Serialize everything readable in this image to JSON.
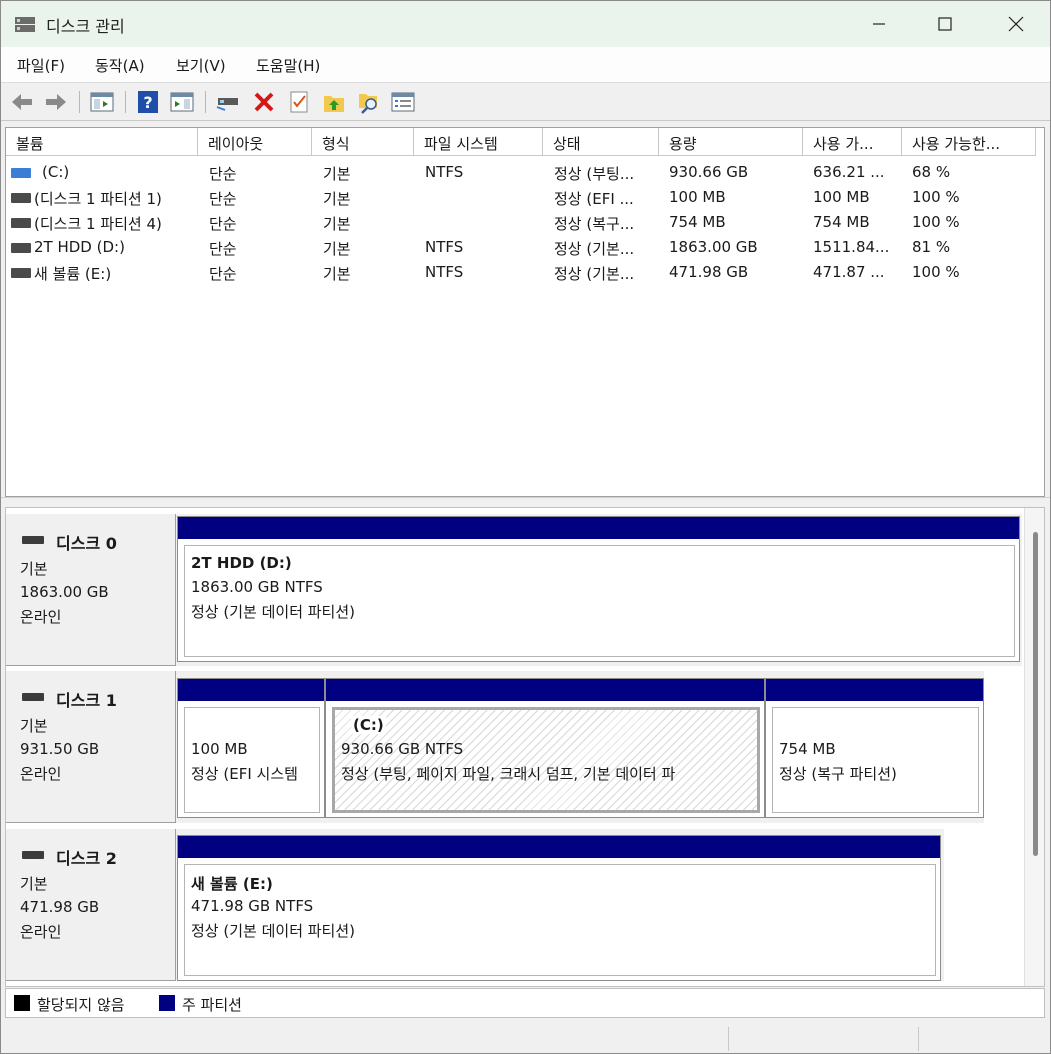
{
  "window": {
    "title": "디스크 관리"
  },
  "menu": [
    "파일(F)",
    "동작(A)",
    "보기(V)",
    "도움말(H)"
  ],
  "toolbar": {
    "icons": [
      "back-arrow-icon",
      "forward-arrow-icon",
      "console-tree-icon",
      "help-icon",
      "action-pane-icon",
      "connect-drive-icon",
      "delete-icon",
      "checklist-icon",
      "folder-up-icon",
      "search-folder-icon",
      "properties-icon"
    ]
  },
  "columns": [
    "볼륨",
    "레이아웃",
    "형식",
    "파일 시스템",
    "상태",
    "용량",
    "사용 가...",
    "사용 가능한..."
  ],
  "volumes": [
    {
      "name": "(C:)",
      "layout": "단순",
      "type": "기본",
      "fs": "NTFS",
      "status": "정상 (부팅...",
      "capacity": "930.66 GB",
      "free": "636.21 ...",
      "percent": "68 %",
      "icon_color": "#3a7ed6"
    },
    {
      "name": "(디스크 1 파티션 1)",
      "layout": "단순",
      "type": "기본",
      "fs": "",
      "status": "정상 (EFI ...",
      "capacity": "100 MB",
      "free": "100 MB",
      "percent": "100 %",
      "icon_color": "#4a4a4a"
    },
    {
      "name": "(디스크 1 파티션 4)",
      "layout": "단순",
      "type": "기본",
      "fs": "",
      "status": "정상 (복구...",
      "capacity": "754 MB",
      "free": "754 MB",
      "percent": "100 %",
      "icon_color": "#4a4a4a"
    },
    {
      "name": "2T HDD (D:)",
      "layout": "단순",
      "type": "기본",
      "fs": "NTFS",
      "status": "정상 (기본...",
      "capacity": "1863.00 GB",
      "free": "1511.84...",
      "percent": "81 %",
      "icon_color": "#4a4a4a"
    },
    {
      "name": "새 볼륨 (E:)",
      "layout": "단순",
      "type": "기본",
      "fs": "NTFS",
      "status": "정상 (기본...",
      "capacity": "471.98 GB",
      "free": "471.87 ...",
      "percent": "100 %",
      "icon_color": "#4a4a4a"
    }
  ],
  "disks": [
    {
      "name": "디스크 0",
      "kind": "기본",
      "size": "1863.00 GB",
      "state": "온라인",
      "partitions": [
        {
          "title": "2T HDD  (D:)",
          "line1": "1863.00 GB NTFS",
          "line2": "정상 (기본 데이터 파티션)"
        }
      ]
    },
    {
      "name": "디스크 1",
      "kind": "기본",
      "size": "931.50 GB",
      "state": "온라인",
      "partitions": [
        {
          "title": "",
          "line1": "100 MB",
          "line2": "정상 (EFI 시스템"
        },
        {
          "title": "(C:)",
          "line1": "930.66 GB NTFS",
          "line2": "정상 (부팅, 페이지 파일, 크래시 덤프, 기본 데이터 파"
        },
        {
          "title": "",
          "line1": "754 MB",
          "line2": "정상 (복구 파티션)"
        }
      ]
    },
    {
      "name": "디스크 2",
      "kind": "기본",
      "size": "471.98 GB",
      "state": "온라인",
      "partitions": [
        {
          "title": "새 볼륨  (E:)",
          "line1": "471.98 GB NTFS",
          "line2": "정상 (기본 데이터 파티션)"
        }
      ]
    }
  ],
  "legend": [
    {
      "label": "할당되지 않음",
      "color": "#000000"
    },
    {
      "label": "주 파티션",
      "color": "#000080"
    }
  ]
}
